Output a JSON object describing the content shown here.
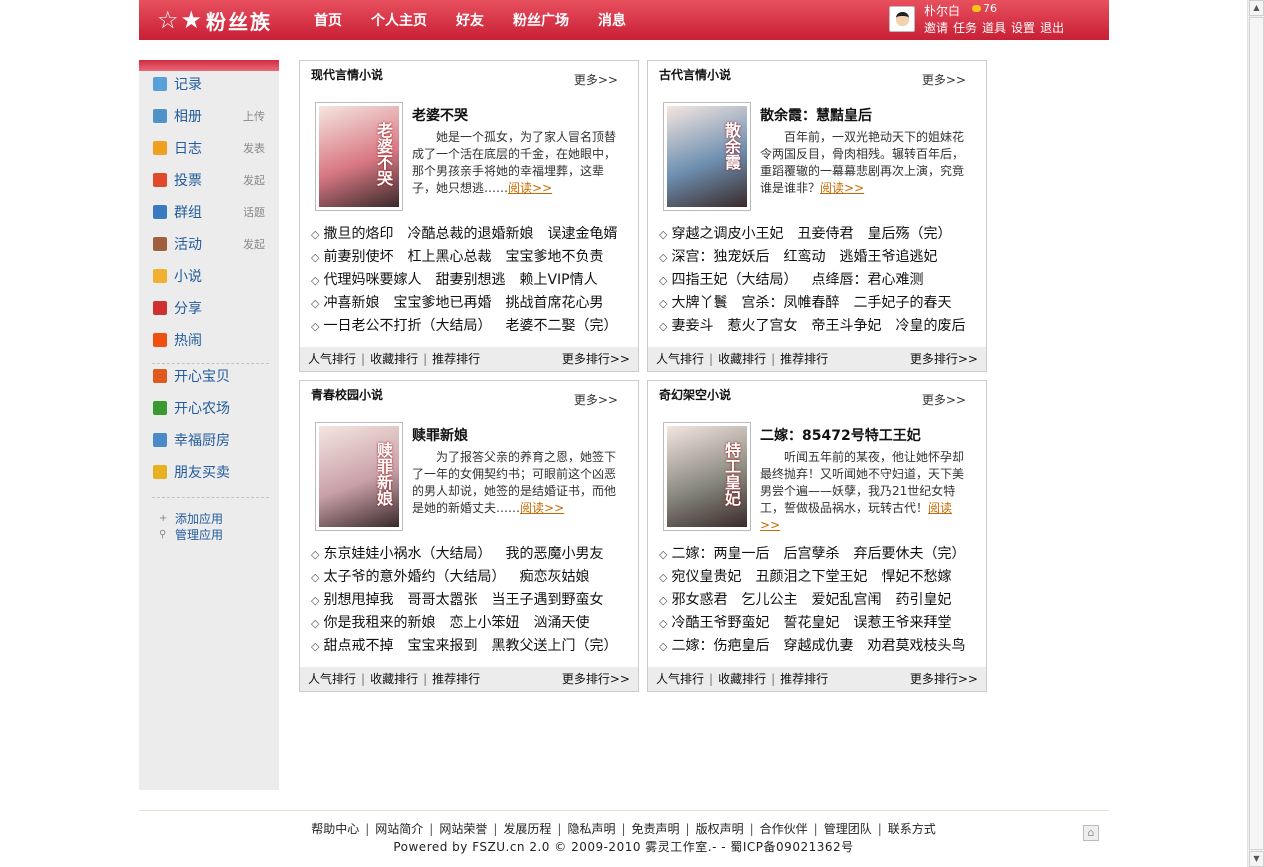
{
  "header": {
    "logo_text": "粉丝族",
    "nav": [
      "首页",
      "个人主页",
      "好友",
      "粉丝广场",
      "消息"
    ],
    "user": {
      "name": "朴尔白",
      "coins": "76",
      "links": [
        "邀请",
        "任务",
        "道具",
        "设置",
        "退出"
      ]
    }
  },
  "sidebar": {
    "items": [
      {
        "label": "记录",
        "action": "",
        "icon": "chat-bubble-icon",
        "color": "#5aa0d8"
      },
      {
        "label": "相册",
        "action": "上传",
        "icon": "photo-album-icon",
        "color": "#4f92c8"
      },
      {
        "label": "日志",
        "action": "发表",
        "icon": "diary-icon",
        "color": "#f0a020"
      },
      {
        "label": "投票",
        "action": "发起",
        "icon": "bar-chart-icon",
        "color": "#e04a2a"
      },
      {
        "label": "群组",
        "action": "话题",
        "icon": "group-icon",
        "color": "#3a7ac0"
      },
      {
        "label": "活动",
        "action": "发起",
        "icon": "calendar-icon",
        "color": "#a06040"
      },
      {
        "label": "小说",
        "action": "",
        "icon": "novel-icon",
        "color": "#f0b030"
      },
      {
        "label": "分享",
        "action": "",
        "icon": "share-heart-icon",
        "color": "#d03030"
      },
      {
        "label": "热闹",
        "action": "",
        "icon": "flame-icon",
        "color": "#f05010"
      }
    ],
    "apps": [
      {
        "label": "开心宝贝",
        "icon": "pet-icon",
        "color": "#e05a20"
      },
      {
        "label": "开心农场",
        "icon": "sprout-icon",
        "color": "#3a9a30"
      },
      {
        "label": "幸福厨房",
        "icon": "kitchen-icon",
        "color": "#4a8ac8"
      },
      {
        "label": "朋友买卖",
        "icon": "coins-icon",
        "color": "#e8b020"
      }
    ],
    "manage": [
      "添加应用",
      "管理应用"
    ]
  },
  "boxes": [
    {
      "title": "现代言情小说",
      "more": "更多>>",
      "cover_text": "老婆不哭",
      "cover_bg": "#d97884",
      "book_title": "老婆不哭",
      "desc": "她是一个孤女，为了家人冒名顶替成了一个活在底层的千金，在她眼中，那个男孩亲手将她的幸福埋葬，这辈子，她只想逃……",
      "read": "阅读>>",
      "rows": [
        [
          "撒旦的烙印",
          "冷酷总裁的退婚新娘",
          "误逮金龟婿"
        ],
        [
          "前妻别使坏",
          "杠上黑心总裁",
          "宝宝爹地不负责"
        ],
        [
          "代理妈咪要嫁人",
          "甜妻别想逃",
          "赖上VIP情人"
        ],
        [
          "冲喜新娘",
          "宝宝爹地已再婚",
          "挑战首席花心男"
        ],
        [
          "一日老公不打折（大结局）",
          "老婆不二娶（完）"
        ]
      ],
      "foot": [
        "人气排行",
        "收藏排行",
        "推荐排行"
      ],
      "foot_more": "更多排行>>"
    },
    {
      "title": "古代言情小说",
      "more": "更多>>",
      "cover_text": "散余霞",
      "cover_bg": "#6e8fb0",
      "book_title": "散余霞：慧黠皇后",
      "desc": "百年前，一双光艳动天下的姐妹花令两国反目，骨肉相残。辗转百年后，重蹈覆辙的一幕幕悲剧再次上演，究竟谁是谁非？",
      "read": "阅读>>",
      "rows": [
        [
          "穿越之调皮小王妃",
          "丑妾侍君",
          "皇后殇（完）"
        ],
        [
          "深宫：独宠妖后",
          "红鸾动",
          "逃婚王爷追逃妃"
        ],
        [
          "四指王妃（大结局）",
          "点绛唇：君心难测"
        ],
        [
          "大牌丫鬟",
          "宫杀：凤帷春醉",
          "二手妃子的春天"
        ],
        [
          "妻妾斗",
          "惹火了宫女",
          "帝王斗争妃",
          "冷皇的废后"
        ]
      ],
      "foot": [
        "人气排行",
        "收藏排行",
        "推荐排行"
      ],
      "foot_more": "更多排行>>"
    },
    {
      "title": "青春校园小说",
      "more": "更多>>",
      "cover_text": "赎罪新娘",
      "cover_bg": "#c9a0a8",
      "book_title": "赎罪新娘",
      "desc": "为了报答父亲的养育之恩，她签下了一年的女佣契约书；可眼前这个凶恶的男人却说，她签的是结婚证书，而他是她的新婚丈夫……",
      "read": "阅读>>",
      "rows": [
        [
          "东京娃娃小祸水（大结局）",
          "我的恶魔小男友"
        ],
        [
          "太子爷的意外婚约（大结局）",
          "痴恋灰姑娘"
        ],
        [
          "别想甩掉我",
          "哥哥太嚣张",
          "当王子遇到野蛮女"
        ],
        [
          "你是我租来的新娘",
          "恋上小笨妞",
          "汹涌天使"
        ],
        [
          "甜点戒不掉",
          "宝宝来报到",
          "黑教父送上门（完）"
        ]
      ],
      "foot": [
        "人气排行",
        "收藏排行",
        "推荐排行"
      ],
      "foot_more": "更多排行>>"
    },
    {
      "title": "奇幻架空小说",
      "more": "更多>>",
      "cover_text": "特工皇妃",
      "cover_bg": "#8a8a80",
      "book_title": "二嫁：85472号特工王妃",
      "desc": "听闻五年前的某夜，他让她怀孕却最终抛弃！又听闻她不守妇道，天下美男尝个遍——妖孽，我乃21世纪女特工，誓做极品祸水，玩转古代！",
      "read": "阅读>>",
      "rows": [
        [
          "二嫁：两皇一后",
          "后宫孽杀",
          "弃后要休夫（完）"
        ],
        [
          "宛仪皇贵妃",
          "丑颜泪之下堂王妃",
          "悍妃不愁嫁"
        ],
        [
          "邪女惑君",
          "乞儿公主",
          "爱妃乱宫闱",
          "药引皇妃"
        ],
        [
          "冷酷王爷野蛮妃",
          "誓花皇妃",
          "误惹王爷来拜堂"
        ],
        [
          "二嫁：伤疤皇后",
          "穿越成仇妻",
          "劝君莫戏枝头鸟"
        ]
      ],
      "foot": [
        "人气排行",
        "收藏排行",
        "推荐排行"
      ],
      "foot_more": "更多排行>>"
    }
  ],
  "footer": {
    "links": [
      "帮助中心",
      "网站简介",
      "网站荣誉",
      "发展历程",
      "隐私声明",
      "免责声明",
      "版权声明",
      "合作伙伴",
      "管理团队",
      "联系方式"
    ],
    "copyright": "Powered by FSZU.cn 2.0 © 2009-2010 雾灵工作室.- - 蜀ICP备09021362号"
  }
}
